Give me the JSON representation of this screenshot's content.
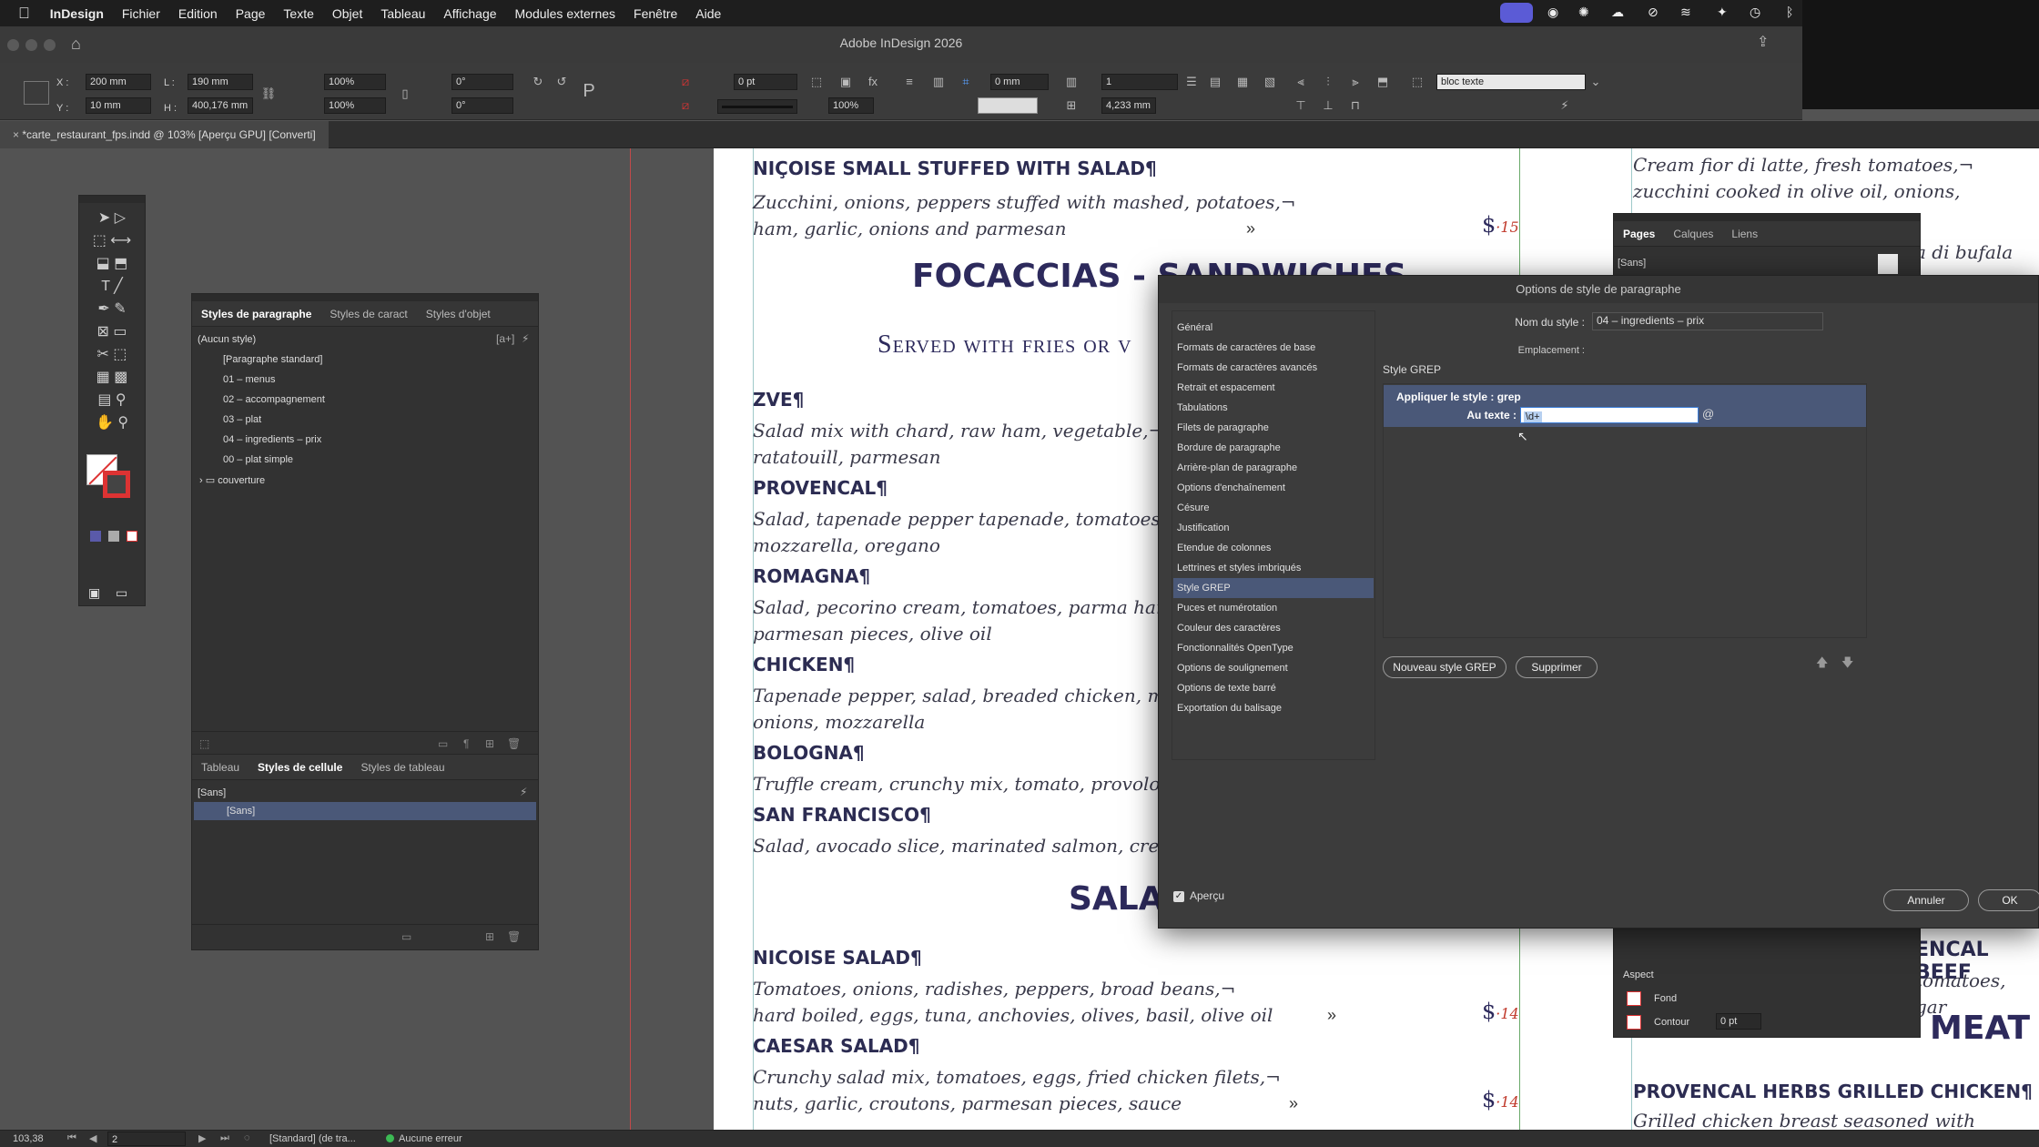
{
  "menubar": {
    "app": "InDesign",
    "items": [
      "Fichier",
      "Edition",
      "Page",
      "Texte",
      "Objet",
      "Tableau",
      "Affichage",
      "Modules externes",
      "Fenêtre",
      "Aide"
    ]
  },
  "window": {
    "title": "Adobe InDesign 2026"
  },
  "control": {
    "x": "200 mm",
    "y": "10 mm",
    "w": "190 mm",
    "h": "400,176 mm",
    "scale_x": "100%",
    "scale_y": "100%",
    "rotate": "0°",
    "shear": "0°",
    "stroke": "0 pt",
    "frame_scale": "100%",
    "offset": "0 mm",
    "columns": "1",
    "gutter": "4,233 mm",
    "style": "bloc texte"
  },
  "doc_tab": "*carte_restaurant_fps.indd @ 103% [Aperçu GPU] [Converti]",
  "menu": {
    "items": [
      {
        "name": "NIÇOISE SMALL STUFFED WITH SALAD¶",
        "desc1": "Zucchini, onions, peppers stuffed with mashed, potatoes,¬",
        "desc2": "ham, garlic, onions and parmesan",
        "price": "$",
        "cents": "15"
      },
      {
        "name": "ZVE¶",
        "desc1": "Salad mix with chard, raw ham, vegetable,¬",
        "desc2": "ratatouill, parmesan"
      },
      {
        "name": "PROVENCAL¶",
        "desc1": "Salad, tapenade pepper tapenade, tomatoes, speck, b",
        "desc2": "mozzarella, oregano"
      },
      {
        "name": "ROMAGNA¶",
        "desc1": "Salad, pecorino cream, tomatoes, parma ham,grilled",
        "desc2": "parmesan pieces, olive oil"
      },
      {
        "name": "CHICKEN¶",
        "desc1": "Tapenade pepper, salad, breaded chicken, marinate",
        "desc2": "onions, mozzarella"
      },
      {
        "name": "BOLOGNA¶",
        "desc1": "Truffle cream, crunchy mix, tomato, provolone, bolog"
      },
      {
        "name": "SAN FRANCISCO¶",
        "desc1": "Salad, avocado slice, marinated salmon, cream che"
      },
      {
        "name": "NICOISE SALAD¶",
        "desc1": "Tomatoes, onions, radishes, peppers, broad beans,¬",
        "desc2": "hard boiled, eggs, tuna, anchovies, olives, basil, olive oil",
        "price": "$",
        "cents": "14"
      },
      {
        "name": "CAESAR SALAD¶",
        "desc1": "Crunchy salad mix, tomatoes, eggs, fried chicken filets,¬",
        "desc2": "nuts, garlic, croutons, parmesan pieces, sauce",
        "price": "$",
        "cents": "14"
      }
    ],
    "section1": "FOCACCIAS - SANDWICHES",
    "section1_sub": "Served with fries or v",
    "section2": "SALA",
    "right": {
      "l1": "Cream fior di latte, fresh tomatoes,¬",
      "l2": "zucchini cooked in olive oil, onions, parmesan",
      "l3": "a di bufala",
      "beef": "ENCAL BEEF",
      "beef_desc": "tomatoes, gar",
      "meat": "MEAT",
      "chicken": "PROVENCAL HERBS GRILLED CHICKEN¶",
      "chicken_desc": "Grilled chicken breast seasoned with garlic, ore"
    }
  },
  "para_panel": {
    "tabs": [
      "Styles de paragraphe",
      "Styles de caract",
      "Styles d'objet"
    ],
    "current": "(Aucun style)",
    "styles": [
      "[Paragraphe standard]",
      "01 – menus",
      "02 – accompagnement",
      "03 – plat",
      "04 – ingredients – prix",
      "00 – plat simple"
    ],
    "folder": "couverture"
  },
  "cell_panel": {
    "tabs": [
      "Tableau",
      "Styles de cellule",
      "Styles de tableau"
    ],
    "current": "[Sans]",
    "selected": "[Sans]"
  },
  "pages_panel": {
    "tabs": [
      "Pages",
      "Calques",
      "Liens"
    ],
    "row": "[Sans]",
    "aspect": "Aspect",
    "fill": "Fond",
    "stroke": "Contour",
    "stroke_val": "0 pt"
  },
  "dialog": {
    "title": "Options de style de paragraphe",
    "categories": [
      "Général",
      "Formats de caractères de base",
      "Formats de caractères avancés",
      "Retrait et espacement",
      "Tabulations",
      "Filets de paragraphe",
      "Bordure de paragraphe",
      "Arrière-plan de paragraphe",
      "Options d'enchaînement",
      "Césure",
      "Justification",
      "Etendue de colonnes",
      "Lettrines et styles imbriqués",
      "Style GREP",
      "Puces et numérotation",
      "Couleur des caractères",
      "Fonctionnalités OpenType",
      "Options de soulignement",
      "Options de texte barré",
      "Exportation du balisage"
    ],
    "selected": "Style GREP",
    "name_label": "Nom du style :",
    "name_value": "04 – ingredients – prix",
    "location_label": "Emplacement :",
    "section": "Style GREP",
    "apply_label": "Appliquer le style : grep",
    "text_label": "Au texte :",
    "text_value": "\\d+",
    "new_grep": "Nouveau style GREP",
    "delete": "Supprimer",
    "preview": "Aperçu",
    "cancel": "Annuler",
    "ok": "OK"
  },
  "status": {
    "zoom": "103,38",
    "page": "2",
    "profile": "[Standard] (de tra...",
    "errors": "Aucune erreur"
  }
}
